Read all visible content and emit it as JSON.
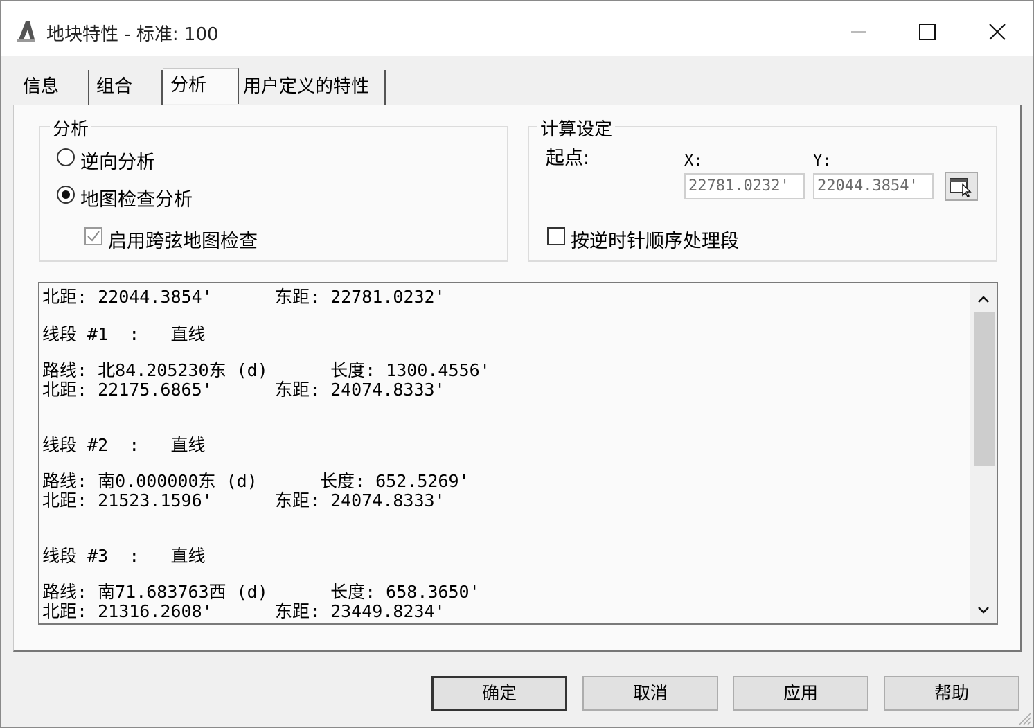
{
  "window": {
    "title": "地块特性 - 标准: 100",
    "icon": "autocad-a-icon"
  },
  "tabs": [
    {
      "label": "信息",
      "active": false
    },
    {
      "label": "组合",
      "active": false
    },
    {
      "label": "分析",
      "active": true
    },
    {
      "label": "用户定义的特性",
      "active": false
    }
  ],
  "analysis_group": {
    "legend": "分析",
    "options": [
      {
        "label": "逆向分析",
        "selected": false
      },
      {
        "label": "地图检查分析",
        "selected": true
      }
    ],
    "checkbox": {
      "label": "启用跨弦地图检查",
      "checked": true,
      "enabled": false
    }
  },
  "calc_group": {
    "legend": "计算设定",
    "start_label": "起点:",
    "x_label": "X:",
    "y_label": "Y:",
    "x_value": "22781.0232'",
    "y_value": "22044.3854'",
    "counterclockwise": {
      "label": "按逆时针顺序处理段",
      "checked": false
    }
  },
  "output_lines": [
    "北距: 22044.3854'      东距: 22781.0232'",
    "线段 #1  :   直线",
    "路线: 北84.205230东 (d)      长度: 1300.4556'",
    "北距: 22175.6865'      东距: 24074.8333'",
    "线段 #2  :   直线",
    "路线: 南0.000000东 (d)      长度: 652.5269'",
    "北距: 21523.1596'      东距: 24074.8333'",
    "线段 #3  :   直线",
    "路线: 南71.683763西 (d)      长度: 658.3650'",
    "北距: 21316.2608'      东距: 23449.8234'"
  ],
  "buttons": {
    "ok": "确定",
    "cancel": "取消",
    "apply": "应用",
    "help": "帮助"
  }
}
